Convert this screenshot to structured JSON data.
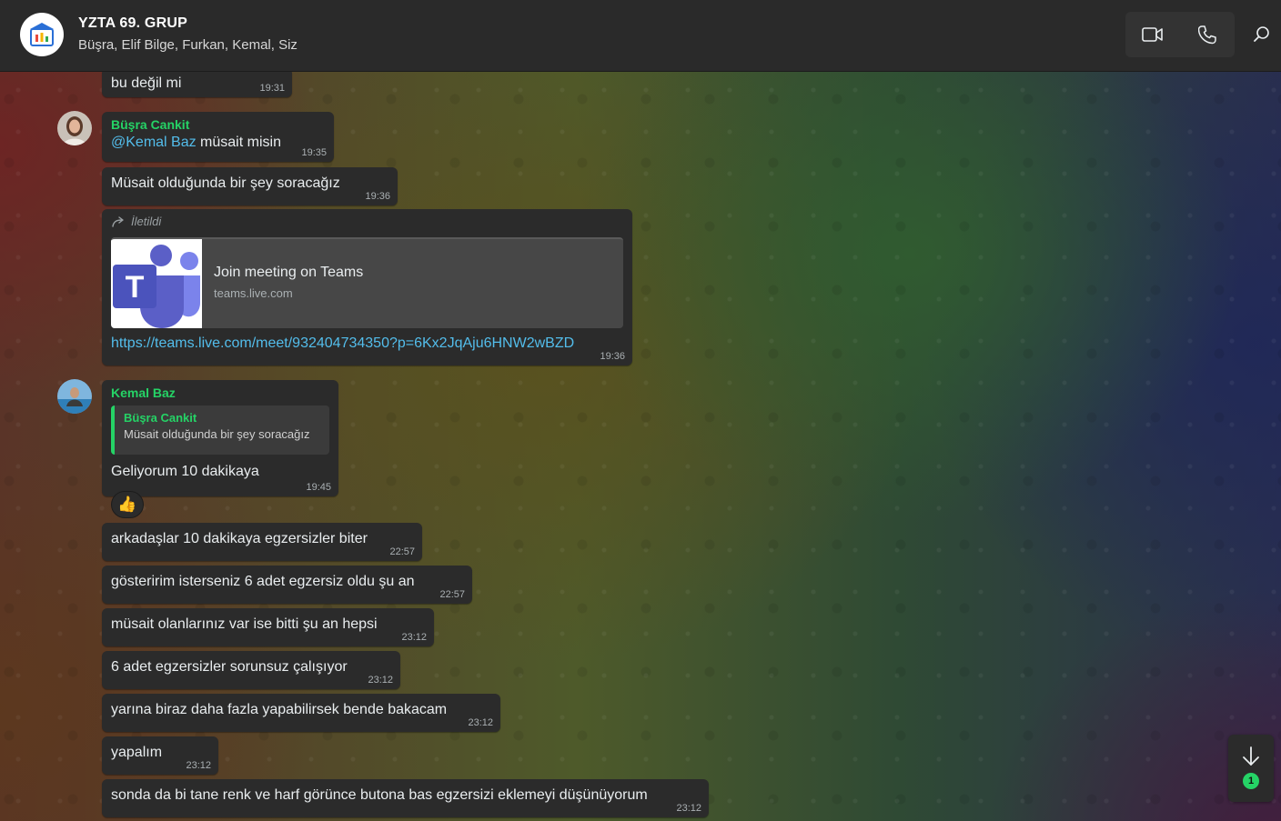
{
  "header": {
    "title": "YZTA 69. GRUP",
    "members": "Büşra, Elif Bilge, Furkan, Kemal, Siz",
    "icons": [
      "video-call-icon",
      "voice-call-icon",
      "search-icon"
    ]
  },
  "messages": [
    {
      "text": "bu değil mi",
      "time": "19:31"
    },
    {
      "sender": "Büşra Cankit",
      "mention": "@Kemal Baz",
      "text": " müsait misin",
      "time": "19:35"
    },
    {
      "text": "Müsait olduğunda bir şey soracağız",
      "time": "19:36"
    },
    {
      "forwarded_label": "İletildi",
      "card_title": "Join meeting on Teams",
      "card_url": "teams.live.com",
      "link": "https://teams.live.com/meet/932404734350?p=6Kx2JqAju6HNW2wBZD",
      "time": "19:36"
    },
    {
      "sender": "Kemal Baz",
      "quote_name": "Büşra Cankit",
      "quote_text": "Müsait olduğunda bir şey soracağız",
      "text": "Geliyorum 10 dakikaya",
      "time": "19:45",
      "reaction": "👍"
    },
    {
      "text": "arkadaşlar 10 dakikaya egzersizler biter",
      "time": "22:57"
    },
    {
      "text": "gösteririm isterseniz 6 adet egzersiz oldu şu an",
      "time": "22:57"
    },
    {
      "text": "müsait olanlarınız var ise bitti şu an hepsi",
      "time": "23:12"
    },
    {
      "text": "6 adet egzersizler sorunsuz çalışıyor",
      "time": "23:12"
    },
    {
      "text": "yarına biraz daha fazla yapabilirsek bende bakacam",
      "time": "23:12"
    },
    {
      "text": "yapalım",
      "time": "23:12"
    },
    {
      "text": "sonda da bi tane renk ve harf görünce butona bas egzersizi eklemeyi düşünüyorum",
      "time": "23:12"
    }
  ],
  "scroll": {
    "unread_count": "1"
  },
  "colors": {
    "accent": "#25d366",
    "link": "#53bdeb",
    "bubble": "#2b2b2b",
    "header": "#2a2a2a"
  }
}
